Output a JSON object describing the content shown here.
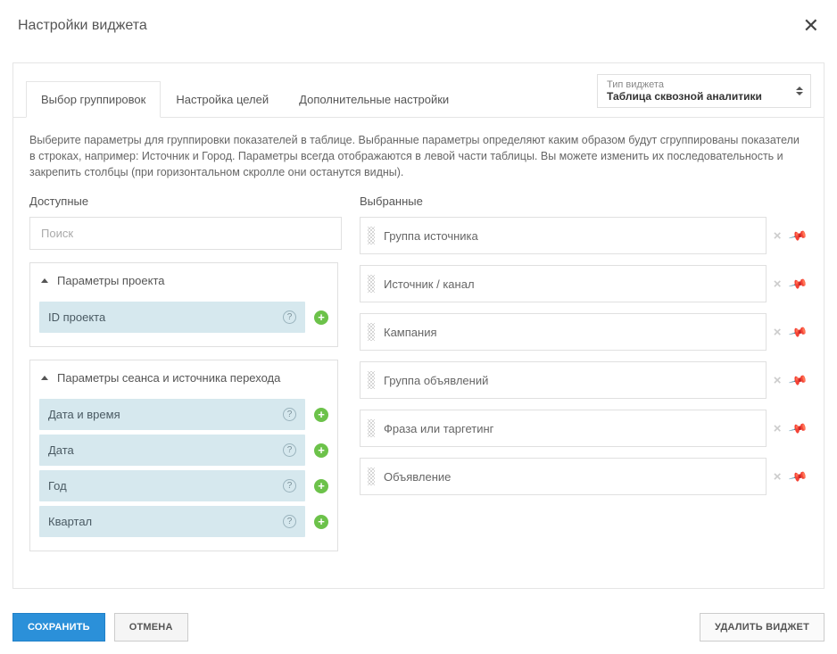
{
  "modal": {
    "title": "Настройки виджета"
  },
  "widget_type": {
    "label": "Тип виджета",
    "value": "Таблица сквозной аналитики"
  },
  "tabs": [
    {
      "label": "Выбор группировок",
      "active": true
    },
    {
      "label": "Настройка целей",
      "active": false
    },
    {
      "label": "Дополнительные настройки",
      "active": false
    }
  ],
  "description": "Выберите параметры для группировки показателей в таблице. Выбранные параметры определяют каким образом будут сгруппированы показатели в строках, например: Источник и Город. Параметры всегда отображаются в левой части таблицы. Вы можете изменить их последовательность и закрепить столбцы (при горизонтальном скролле они останутся видны).",
  "available": {
    "title": "Доступные",
    "search_placeholder": "Поиск",
    "groups": [
      {
        "title": "Параметры проекта",
        "items": [
          {
            "label": "ID проекта"
          }
        ]
      },
      {
        "title": "Параметры сеанса и источника перехода",
        "items": [
          {
            "label": "Дата и время"
          },
          {
            "label": "Дата"
          },
          {
            "label": "Год"
          },
          {
            "label": "Квартал"
          }
        ]
      }
    ]
  },
  "selected": {
    "title": "Выбранные",
    "items": [
      {
        "label": "Группа источника",
        "pinned": true
      },
      {
        "label": "Источник / канал",
        "pinned": true
      },
      {
        "label": "Кампания",
        "pinned": true
      },
      {
        "label": "Группа объявлений",
        "pinned": false
      },
      {
        "label": "Фраза или таргетинг",
        "pinned": false
      },
      {
        "label": "Объявление",
        "pinned": false
      }
    ]
  },
  "footer": {
    "save": "Сохранить",
    "cancel": "Отмена",
    "delete": "Удалить виджет"
  }
}
